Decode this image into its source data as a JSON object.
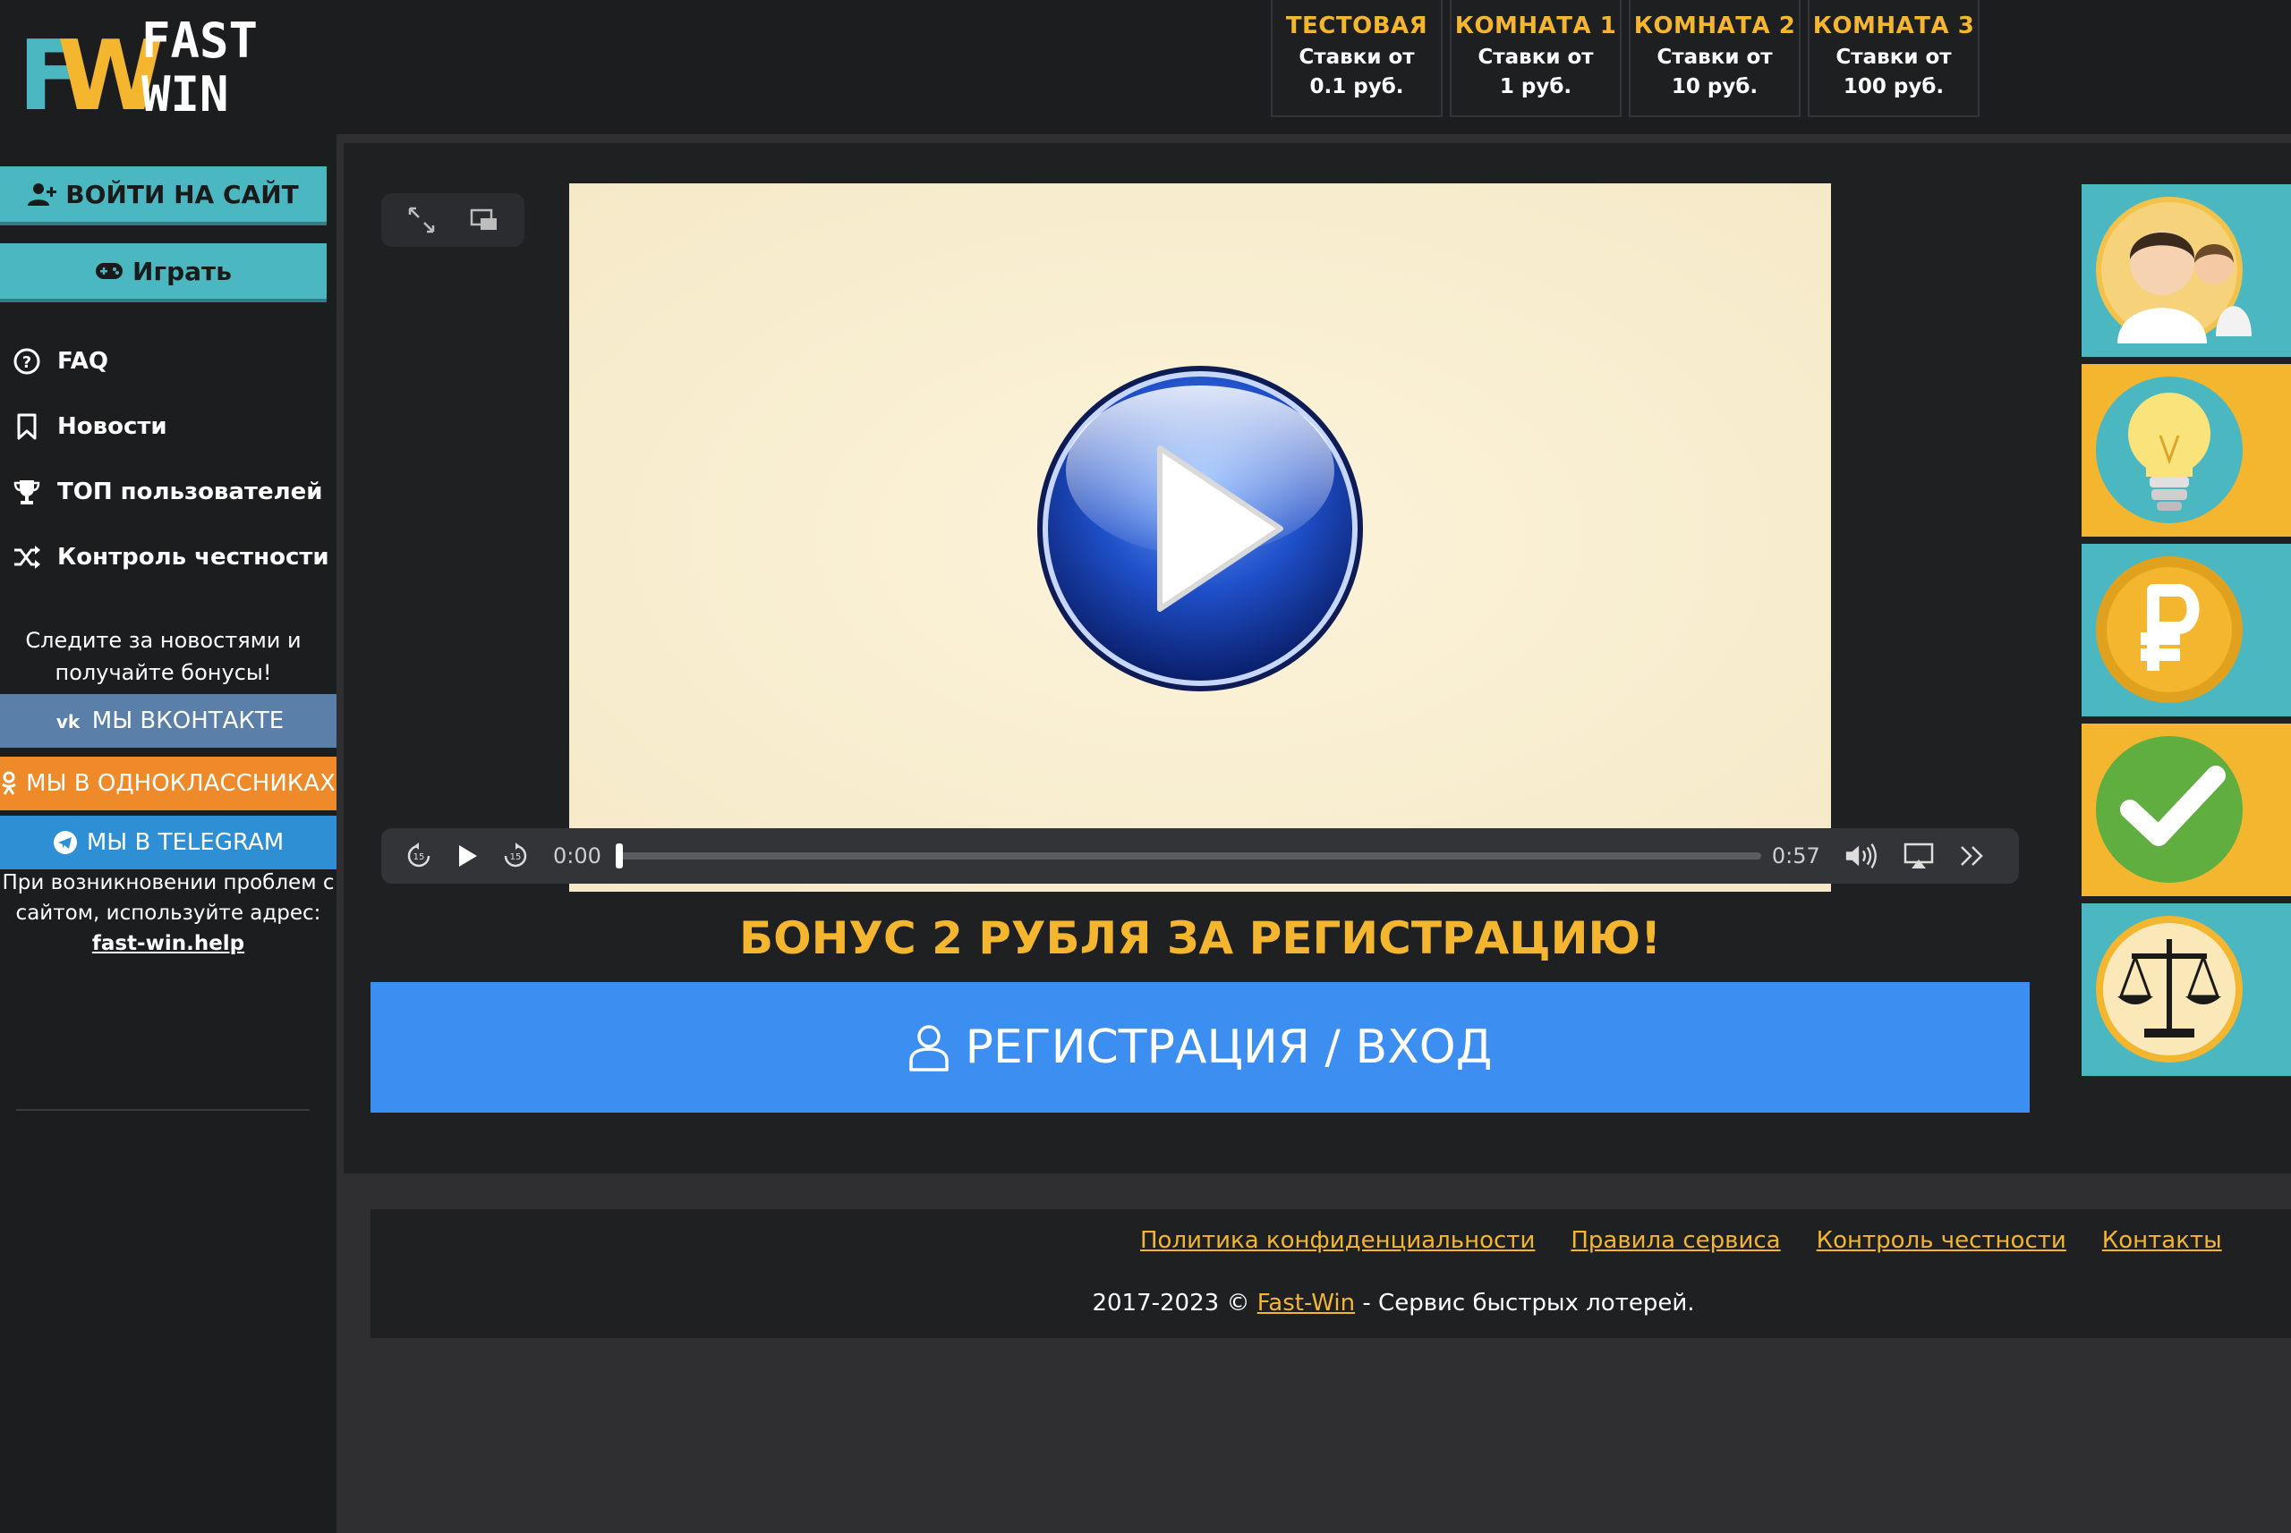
{
  "logo": {
    "line1": "FAST",
    "line2": "WIN"
  },
  "rooms": [
    {
      "title": "ТЕСТОВАЯ",
      "line1": "Ставки от",
      "line2": "0.1 руб."
    },
    {
      "title": "КОМНАТА 1",
      "line1": "Ставки от",
      "line2": "1 руб."
    },
    {
      "title": "КОМНАТА 2",
      "line1": "Ставки от",
      "line2": "10 руб."
    },
    {
      "title": "КОМНАТА 3",
      "line1": "Ставки от",
      "line2": "100 руб."
    }
  ],
  "sidebar": {
    "login_label": "ВОЙТИ НА САЙТ",
    "play_label": "Играть",
    "nav": [
      {
        "label": "FAQ",
        "icon": "question-circle-icon"
      },
      {
        "label": "Новости",
        "icon": "bookmark-icon"
      },
      {
        "label": "ТОП пользователей",
        "icon": "trophy-icon"
      },
      {
        "label": "Контроль честности",
        "icon": "shuffle-icon"
      }
    ],
    "follow_line1": "Следите за новостями и",
    "follow_line2": "получайте бонусы!",
    "vk_label": "МЫ ВКОНТАКТЕ",
    "ok_label": "МЫ В ОДНОКЛАССНИКАХ",
    "tg_label": "МЫ В TELEGRAM",
    "help_line1": "При возникновении проблем с",
    "help_line2": "сайтом, используйте адрес:",
    "help_link": "fast-win.help"
  },
  "player": {
    "current_time": "0:00",
    "duration": "0:57",
    "progress": 0
  },
  "bonus_text": "БОНУС 2 РУБЛЯ ЗА РЕГИСТРАЦИЮ!",
  "register_label": "РЕГИСТРАЦИЯ / ВХОД",
  "right_icons": [
    "users-icon",
    "lightbulb-icon",
    "ruble-coin-icon",
    "checkmark-icon",
    "scales-icon"
  ],
  "footer": {
    "links": [
      "Политика конфиденциальности",
      "Правила сервиса",
      "Контроль честности",
      "Контакты"
    ],
    "copyright_prefix": "2017-2023 ©",
    "copyright_brand": "Fast-Win",
    "copyright_suffix": "- Сервис быстрых лотерей."
  },
  "colors": {
    "accent_yellow": "#f4b52f",
    "teal": "#4bb7c1",
    "vk": "#5a7fa8",
    "ok": "#ee8a2a",
    "telegram": "#2f8fd4",
    "register_blue": "#3c8ef0"
  }
}
